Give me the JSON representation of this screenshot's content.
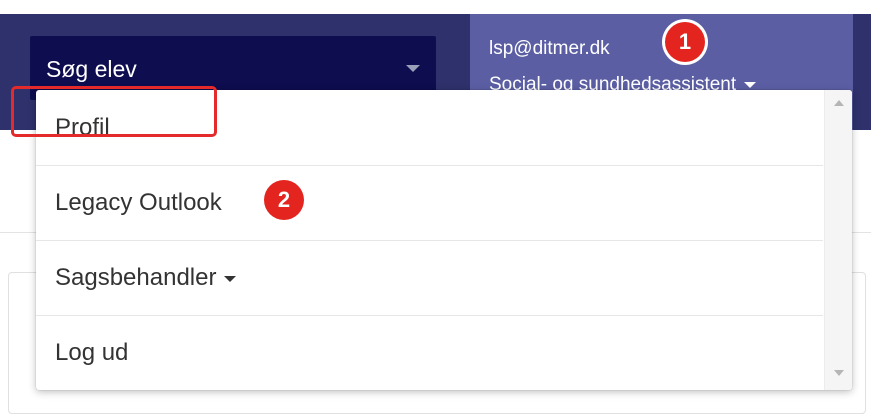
{
  "header": {
    "search_label": "Søg elev",
    "user_email": "lsp@ditmer.dk",
    "user_role": "Social- og sundhedsassistent"
  },
  "menu": {
    "items": [
      {
        "label": "Profil"
      },
      {
        "label": "Legacy Outlook"
      },
      {
        "label": "Sagsbehandler",
        "has_caret": true
      },
      {
        "label": "Log ud"
      }
    ]
  },
  "annotations": {
    "badge_1": "1",
    "badge_2": "2",
    "highlight_color": "#e42a2a"
  },
  "colors": {
    "topbar": "#2e316b",
    "search_bg": "#0d0d4f",
    "user_block": "#5b5ea3"
  },
  "icons": {
    "search_caret": "caret-down-icon",
    "role_caret": "caret-down-icon",
    "scroll_up": "arrow-up-icon",
    "scroll_down": "arrow-down-icon"
  }
}
